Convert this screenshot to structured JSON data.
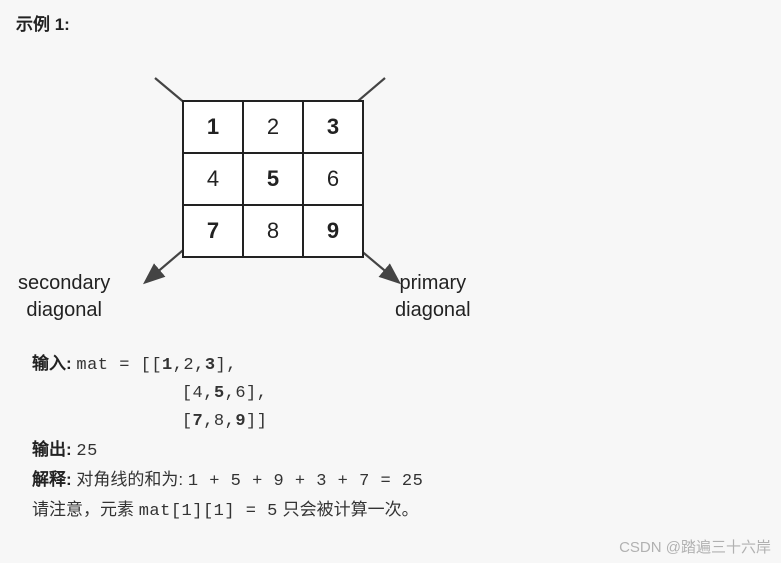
{
  "heading": "示例 1:",
  "diagram": {
    "grid": [
      [
        {
          "v": "1",
          "bold": true
        },
        {
          "v": "2",
          "bold": false
        },
        {
          "v": "3",
          "bold": true
        }
      ],
      [
        {
          "v": "4",
          "bold": false
        },
        {
          "v": "5",
          "bold": true
        },
        {
          "v": "6",
          "bold": false
        }
      ],
      [
        {
          "v": "7",
          "bold": true
        },
        {
          "v": "8",
          "bold": false
        },
        {
          "v": "9",
          "bold": true
        }
      ]
    ],
    "secondary_label_line1": "secondary",
    "secondary_label_line2": "diagonal",
    "primary_label_line1": "primary",
    "primary_label_line2": "diagonal"
  },
  "io": {
    "input_label": "输入:",
    "input_prefix": "mat = [[",
    "input_line1_vals": "1,2,3",
    "input_line1_suffix": "],",
    "input_line2_pad": "              [",
    "input_line2_vals": "4,5,6",
    "input_line2_suffix": "],",
    "input_line3_pad": "              [",
    "input_line3_vals": "7,8,9",
    "input_line3_suffix": "]]",
    "output_label": "输出:",
    "output_value": "25",
    "explain_label": "解释:",
    "explain_text_prefix": "对角线的和为: ",
    "explain_sum": "1 + 5 + 9 + 3 + 7 = 25",
    "note_prefix": "请注意，元素 ",
    "note_code": "mat[1][1] = 5",
    "note_suffix": " 只会被计算一次。"
  },
  "watermark": "CSDN @踏遍三十六岸",
  "chart_data": {
    "type": "table",
    "title": "3x3 矩阵对角线示意",
    "grid": [
      [
        1,
        2,
        3
      ],
      [
        4,
        5,
        6
      ],
      [
        7,
        8,
        9
      ]
    ],
    "primary_diagonal": [
      1,
      5,
      9
    ],
    "secondary_diagonal": [
      3,
      5,
      7
    ],
    "diagonal_sum": 25
  }
}
